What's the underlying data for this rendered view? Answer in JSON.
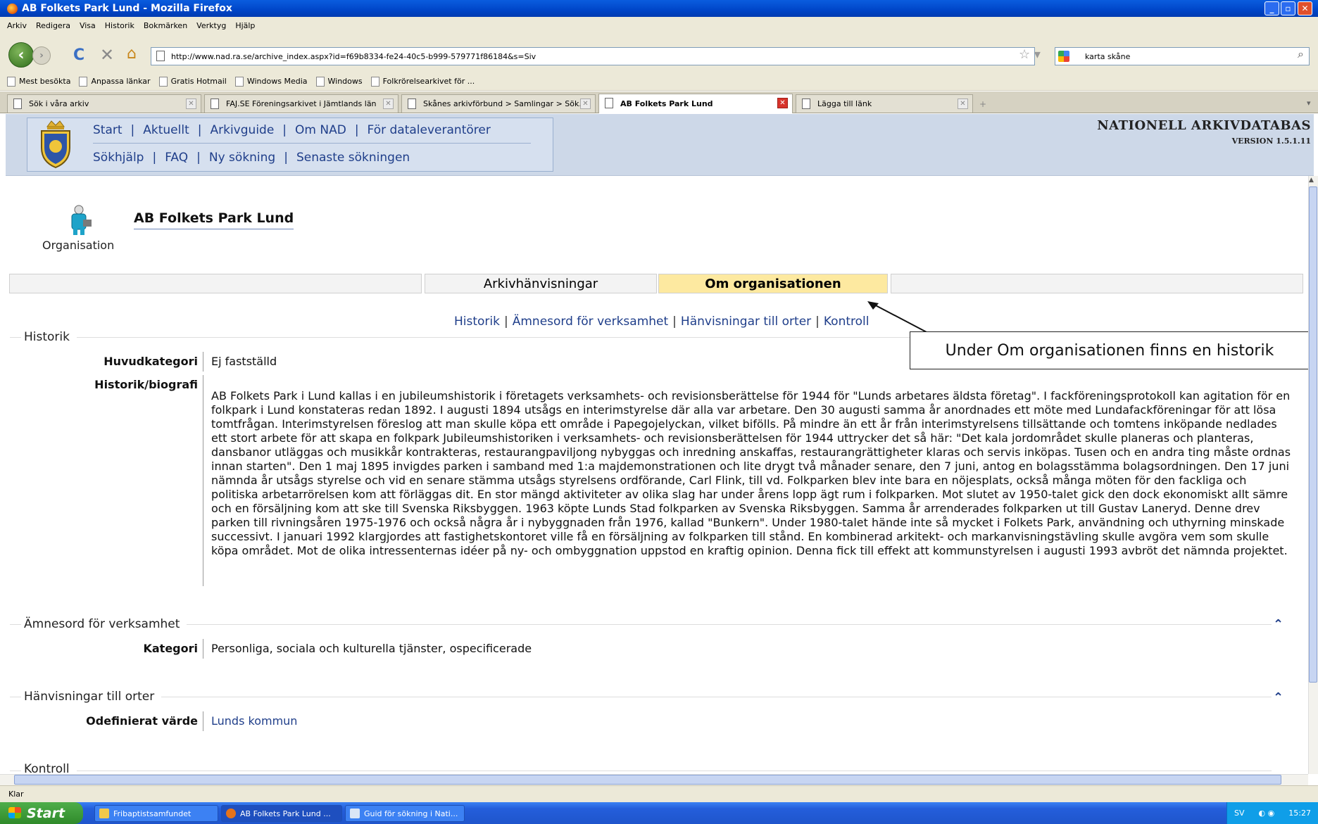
{
  "window": {
    "title": "AB Folkets Park Lund - Mozilla Firefox"
  },
  "menu": [
    "Arkiv",
    "Redigera",
    "Visa",
    "Historik",
    "Bokmärken",
    "Verktyg",
    "Hjälp"
  ],
  "browser": {
    "url": "http://www.nad.ra.se/archive_index.aspx?id=f69b8334-fe24-40c5-b999-579771f86184&s=Siv",
    "search_value": "karta skåne"
  },
  "bookmarks": [
    "Mest besökta",
    "Anpassa länkar",
    "Gratis Hotmail",
    "Windows Media",
    "Windows",
    "Folkrörelsearkivet för ..."
  ],
  "tabs": [
    {
      "label": "Sök i våra arkiv"
    },
    {
      "label": "FAJ.SE Föreningsarkivet i Jämtlands län"
    },
    {
      "label": "Skånes arkivförbund > Samlingar > Sök..."
    },
    {
      "label": "AB Folkets Park Lund",
      "active": true
    },
    {
      "label": "Lägga till länk"
    }
  ],
  "site": {
    "nav_row1": [
      "Start",
      "Aktuellt",
      "Arkivguide",
      "Om NAD",
      "För dataleverantörer"
    ],
    "nav_row2": [
      "Sökhjälp",
      "FAQ",
      "Ny sökning",
      "Senaste sökningen"
    ],
    "brand_title": "NATIONELL ARKIVDATABAS",
    "brand_version": "VERSION 1.5.1.11"
  },
  "page": {
    "org_label": "Organisation",
    "title": "AB Folkets Park Lund",
    "tabs": [
      "Arkivhänvisningar",
      "Om organisationen"
    ],
    "sublinks": [
      "Historik",
      "Ämnesord för verksamhet",
      "Hänvisningar till orter",
      "Kontroll"
    ],
    "historik": {
      "heading": "Historik",
      "huvudkategori_label": "Huvudkategori",
      "huvudkategori_value": "Ej fastställd",
      "bio_label": "Historik/biografi",
      "bio_text": "AB Folkets Park i Lund kallas i en jubileumshistorik i företagets verksamhets- och revisionsberättelse för 1944 för \"Lunds arbetares äldsta företag\". I fackföreningsprotokoll kan agitation för en folkpark i Lund konstateras redan 1892. I augusti 1894 utsågs en interimstyrelse där alla var arbetare. Den 30 augusti samma år anordnades ett möte med Lundafackföreningar för att lösa tomtfrågan. Interimstyrelsen föreslog att man skulle köpa ett område i Papegojelyckan, vilket bifölls. På mindre än ett år från interimstyrelsens tillsättande och tomtens inköpande nedlades ett stort arbete för att skapa en folkpark Jubileumshistoriken i verksamhets- och revisionsberättelsen för 1944 uttrycker det så här: \"Det kala jordområdet skulle planeras och planteras, dansbanor utläggas och musikkår kontrakteras, restaurangpaviljong nybyggas och inredning anskaffas, restaurangrättigheter klaras och servis inköpas. Tusen och en andra ting måste ordnas innan starten\". Den 1 maj 1895 invigdes parken i samband med 1:a majdemonstrationen och lite drygt två månader senare, den 7 juni, antog en bolagsstämma bolagsordningen. Den 17 juni nämnda år utsågs styrelse och vid en senare stämma utsågs styrelsens ordförande, Carl Flink, till vd. Folkparken blev inte bara en nöjesplats, också många möten för den fackliga och politiska arbetarrörelsen kom att förläggas dit. En stor mängd aktiviteter av olika slag har under årens lopp ägt rum i folkparken. Mot slutet av 1950-talet gick den dock ekonomiskt allt sämre och en försäljning kom att ske till Svenska Riksbyggen. 1963 köpte Lunds Stad folkparken av Svenska Riksbyggen. Samma år arrenderades folkparken ut till Gustav Laneryd. Denne drev parken till rivningsåren 1975-1976 och också några år i nybyggnaden från 1976, kallad \"Bunkern\". Under 1980-talet hände inte så mycket i Folkets Park, användning och uthyrning minskade successivt. I januari 1992 klargjordes att fastighetskontoret ville få en försäljning av folkparken till stånd. En kombinerad arkitekt- och markanvisningstävling skulle avgöra vem som skulle köpa området. Mot de olika intressenternas idéer på ny- och ombyggnation uppstod en kraftig opinion. Denna fick till effekt att kommunstyrelsen i augusti 1993 avbröt det nämnda projektet."
    },
    "amnesord": {
      "heading": "Ämnesord för verksamhet",
      "label": "Kategori",
      "value": "Personliga, sociala och kulturella tjänster, ospecificerade"
    },
    "orter": {
      "heading": "Hänvisningar till orter",
      "label": "Odefinierat värde",
      "value": "Lunds kommun"
    },
    "kontroll": {
      "heading": "Kontroll"
    },
    "callout": "Under Om organisationen finns en historik"
  },
  "statusbar": "Klar",
  "taskbar": {
    "start": "Start",
    "items": [
      "Fribaptistsamfundet",
      "AB Folkets Park Lund ...",
      "Guid för sökning i Nati..."
    ],
    "lang": "SV",
    "clock": "15:27"
  }
}
